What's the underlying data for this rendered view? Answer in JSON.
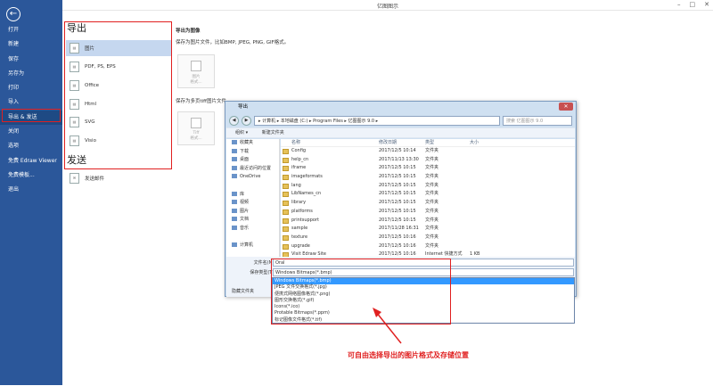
{
  "window": {
    "title": "亿图图示",
    "min": "–",
    "max": "□",
    "close": "✕"
  },
  "sidebar": {
    "back_icon": "←",
    "items": [
      "打开",
      "新建",
      "保存",
      "另存为",
      "打印",
      "导入",
      "导出 & 发送",
      "关闭",
      "选项",
      "免费 Edraw Viewer",
      "免费模板...",
      "退出"
    ]
  },
  "panel": {
    "export_heading": "导出",
    "options": [
      "图片",
      "PDF, PS, EPS",
      "Office",
      "Html",
      "SVG",
      "Visio"
    ],
    "send_heading": "发送",
    "send_mail": "发送邮件"
  },
  "content": {
    "title": "导出为图像",
    "desc": "保存为图片文件，比如BMP, JPEG, PNG, GIF格式。",
    "tile1_label": "图片\n格式...",
    "desc2": "保存为多页tiff图片文件。",
    "tile2_label": "Tiff\n格式..."
  },
  "dialog": {
    "title": "导出",
    "path": "▸ 计算机 ▸ 本地磁盘 (C:) ▸ Program Files ▸ 亿图图示 9.0 ▸",
    "search": "搜索 亿图图示 9.0",
    "organize": "组织 ▾",
    "new_folder": "新建文件夹",
    "tree": [
      "收藏夹",
      "下载",
      "桌面",
      "最近访问的位置",
      "OneDrive",
      "",
      "库",
      "视频",
      "图片",
      "文档",
      "音乐",
      "",
      "计算机"
    ],
    "columns": [
      "名称",
      "修改日期",
      "类型",
      "大小"
    ],
    "files": [
      [
        "Config",
        "2017/12/5 10:14",
        "文件夹",
        ""
      ],
      [
        "help_cn",
        "2017/11/13 13:30",
        "文件夹",
        ""
      ],
      [
        "iframe",
        "2017/12/5 10:15",
        "文件夹",
        ""
      ],
      [
        "imageformats",
        "2017/12/5 10:15",
        "文件夹",
        ""
      ],
      [
        "lang",
        "2017/12/5 10:15",
        "文件夹",
        ""
      ],
      [
        "LibNames_cn",
        "2017/12/5 10:15",
        "文件夹",
        ""
      ],
      [
        "library",
        "2017/12/5 10:15",
        "文件夹",
        ""
      ],
      [
        "platforms",
        "2017/12/5 10:15",
        "文件夹",
        ""
      ],
      [
        "printsupport",
        "2017/12/5 10:15",
        "文件夹",
        ""
      ],
      [
        "sample",
        "2017/11/28 16:31",
        "文件夹",
        ""
      ],
      [
        "texture",
        "2017/12/5 10:16",
        "文件夹",
        ""
      ],
      [
        "upgrade",
        "2017/12/5 10:16",
        "文件夹",
        ""
      ],
      [
        "Visit Edraw Site",
        "2017/12/5 10:16",
        "Internet 快捷方式",
        "1 KB"
      ]
    ],
    "filename_label": "文件名(N):",
    "filename": "Oral",
    "type_label": "保存类型(T):",
    "type_value": "Windows Bitmaps(*.bmp)",
    "hide": "隐藏文件夹",
    "type_options": [
      "Windows Bitmaps(*.bmp)",
      "JPEG 文件交换格式(*.jpg)",
      "便携式网络图像格式(*.png)",
      "图形交换格式(*.gif)",
      "Icons(*.ico)",
      "Protable Bitmaps(*.ppm)",
      "标记图像文件格式(*.tif)"
    ]
  },
  "annotation": "可自由选择导出的图片格式及存储位置",
  "colors": {
    "sidebar": "#2b579a",
    "highlight": "#e02020"
  }
}
